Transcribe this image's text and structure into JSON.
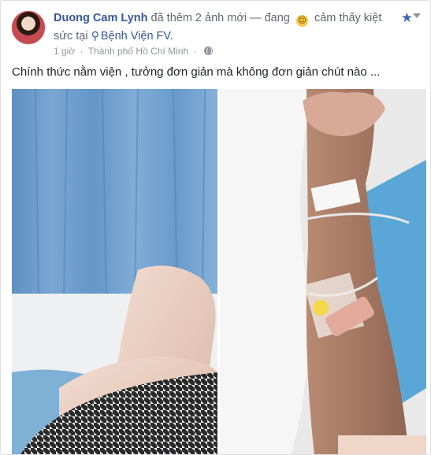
{
  "post": {
    "author": "Duong Cam Lynh",
    "action": "đã thêm 2 ảnh mới — đang",
    "feeling": "cảm thấy kiệt sức tại",
    "feeling_emoji": "😌",
    "location": "Bệnh Viện FV.",
    "time": "1 giờ",
    "separator": "·",
    "city": "Thành phố Hồ Chí Minh",
    "text": "Chính thức nằm viện , tưởng đơn giản mà không đơn giản chút nào ...",
    "icons": {
      "location": "map-pin-icon",
      "privacy": "globe-icon",
      "save": "star-icon",
      "options": "chevron-down-icon"
    },
    "colors": {
      "link": "#365899",
      "meta": "#90949c",
      "save_star": "#4267b2"
    }
  }
}
